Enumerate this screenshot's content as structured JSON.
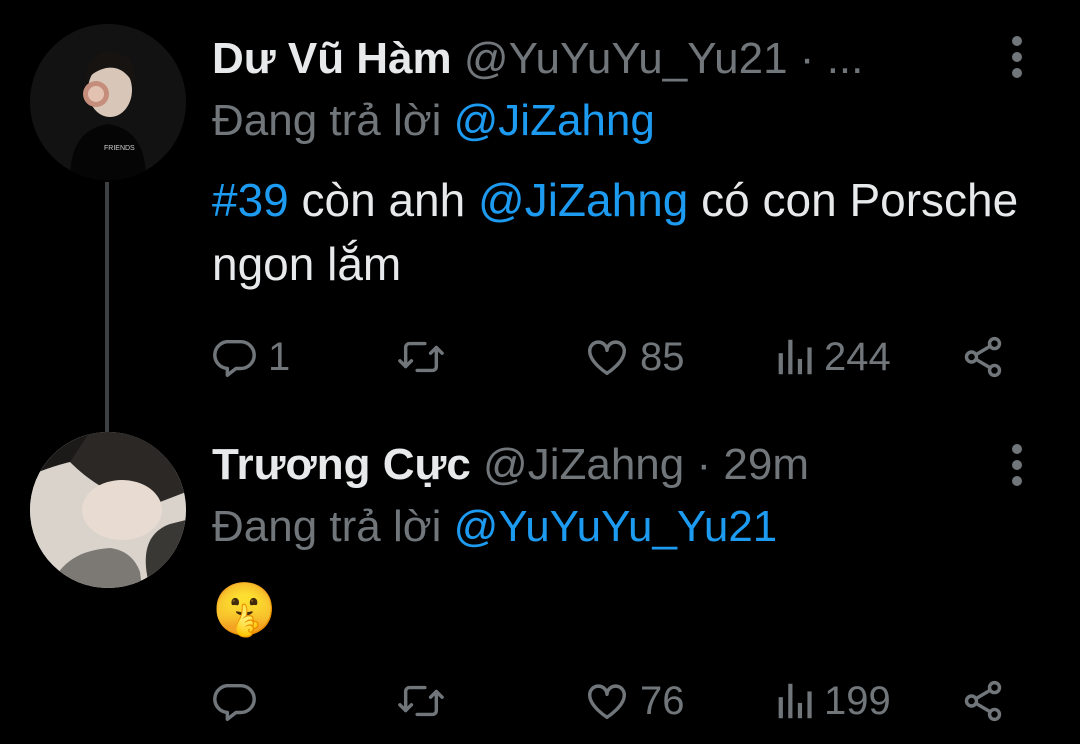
{
  "tweets": [
    {
      "display_name": "Dư Vũ Hàm",
      "handle": "@YuYuYu_Yu21",
      "separator": "·",
      "time": "...",
      "reply_prefix": "Đang trả lời",
      "reply_to": "@JiZahng",
      "hashtag": "#39",
      "text_part_1": " còn anh ",
      "mention": "@JiZahng",
      "text_part_2": " có con Porsche ngon lắm",
      "replies": "1",
      "retweets": "",
      "likes": "85",
      "views": "244"
    },
    {
      "display_name": "Trương Cực",
      "handle": "@JiZahng",
      "separator": "·",
      "time": "29m",
      "reply_prefix": "Đang trả lời",
      "reply_to": "@YuYuYu_Yu21",
      "emoji": "🤫",
      "replies": "",
      "retweets": "",
      "likes": "76",
      "views": "199"
    }
  ],
  "icons": {
    "reply": "reply-icon",
    "retweet": "retweet-icon",
    "like": "heart-icon",
    "views": "views-icon",
    "share": "share-icon",
    "more": "more-vertical-icon"
  },
  "colors": {
    "background": "#000000",
    "primary_text": "#e7e9ea",
    "secondary_text": "#71767b",
    "link": "#1d9bf0",
    "thread_line": "#3e4144"
  }
}
